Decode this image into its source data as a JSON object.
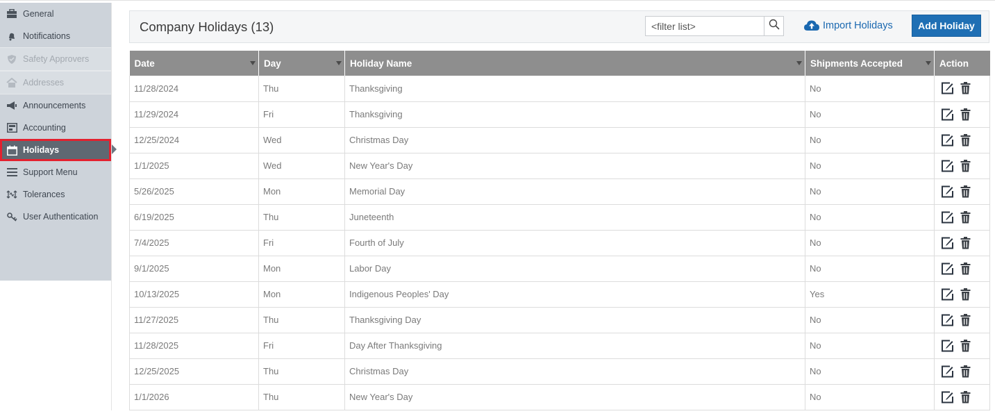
{
  "sidebar": {
    "items": [
      {
        "label": "General",
        "icon": "briefcase-icon"
      },
      {
        "label": "Notifications",
        "icon": "bell-icon"
      },
      {
        "label": "Safety Approvers",
        "icon": "shield-icon",
        "disabled": true
      },
      {
        "label": "Addresses",
        "icon": "home-icon",
        "disabled": true
      },
      {
        "label": "Announcements",
        "icon": "megaphone-icon"
      },
      {
        "label": "Accounting",
        "icon": "ledger-icon"
      },
      {
        "label": "Holidays",
        "icon": "calendar-icon",
        "active": true
      },
      {
        "label": "Support Menu",
        "icon": "menu-icon"
      },
      {
        "label": "Tolerances",
        "icon": "tolerance-icon"
      },
      {
        "label": "User Authentication",
        "icon": "key-icon"
      }
    ]
  },
  "header": {
    "title": "Company Holidays (13)",
    "filter_placeholder": "<filter list>",
    "import_label": "Import Holidays",
    "add_label": "Add Holiday"
  },
  "table": {
    "columns": [
      "Date",
      "Day",
      "Holiday Name",
      "Shipments Accepted",
      "Action"
    ],
    "rows": [
      {
        "date": "11/28/2024",
        "day": "Thu",
        "name": "Thanksgiving",
        "shipments": "No"
      },
      {
        "date": "11/29/2024",
        "day": "Fri",
        "name": "Thanksgiving",
        "shipments": "No"
      },
      {
        "date": "12/25/2024",
        "day": "Wed",
        "name": "Christmas Day",
        "shipments": "No"
      },
      {
        "date": "1/1/2025",
        "day": "Wed",
        "name": "New Year's Day",
        "shipments": "No"
      },
      {
        "date": "5/26/2025",
        "day": "Mon",
        "name": "Memorial Day",
        "shipments": "No"
      },
      {
        "date": "6/19/2025",
        "day": "Thu",
        "name": "Juneteenth",
        "shipments": "No"
      },
      {
        "date": "7/4/2025",
        "day": "Fri",
        "name": "Fourth of July",
        "shipments": "No"
      },
      {
        "date": "9/1/2025",
        "day": "Mon",
        "name": "Labor Day",
        "shipments": "No"
      },
      {
        "date": "10/13/2025",
        "day": "Mon",
        "name": "Indigenous Peoples' Day",
        "shipments": "Yes"
      },
      {
        "date": "11/27/2025",
        "day": "Thu",
        "name": "Thanksgiving Day",
        "shipments": "No"
      },
      {
        "date": "11/28/2025",
        "day": "Fri",
        "name": "Day After Thanksgiving",
        "shipments": "No"
      },
      {
        "date": "12/25/2025",
        "day": "Thu",
        "name": "Christmas Day",
        "shipments": "No"
      },
      {
        "date": "1/1/2026",
        "day": "Thu",
        "name": "New Year's Day",
        "shipments": "No"
      }
    ],
    "row_actions": [
      "edit-icon",
      "trash-icon"
    ]
  },
  "colors": {
    "accent": "#1f6fb4",
    "link": "#1a68b0",
    "sidebar_bg": "#cdd3da",
    "active_item_bg": "#5f6872",
    "highlight_outline": "#e3212f",
    "table_header_bg": "#8e8e8e"
  }
}
